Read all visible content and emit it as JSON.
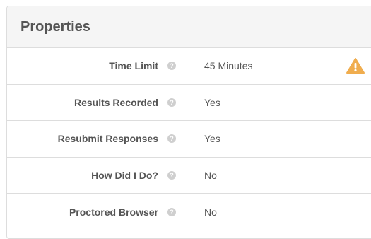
{
  "panel": {
    "title": "Properties"
  },
  "rows": [
    {
      "label": "Time Limit",
      "value": "45 Minutes",
      "warning": true
    },
    {
      "label": "Results Recorded",
      "value": "Yes",
      "warning": false
    },
    {
      "label": "Resubmit Responses",
      "value": "Yes",
      "warning": false
    },
    {
      "label": "How Did I Do?",
      "value": "No",
      "warning": false
    },
    {
      "label": "Proctored Browser",
      "value": "No",
      "warning": false
    }
  ],
  "icons": {
    "help": "question-circle-icon",
    "warning": "warning-triangle-icon",
    "help_glyph": "?"
  },
  "colors": {
    "warning": "#f0ad4e",
    "header_bg": "#f5f5f5",
    "text": "#555555",
    "help_icon": "#cfcfcf"
  }
}
